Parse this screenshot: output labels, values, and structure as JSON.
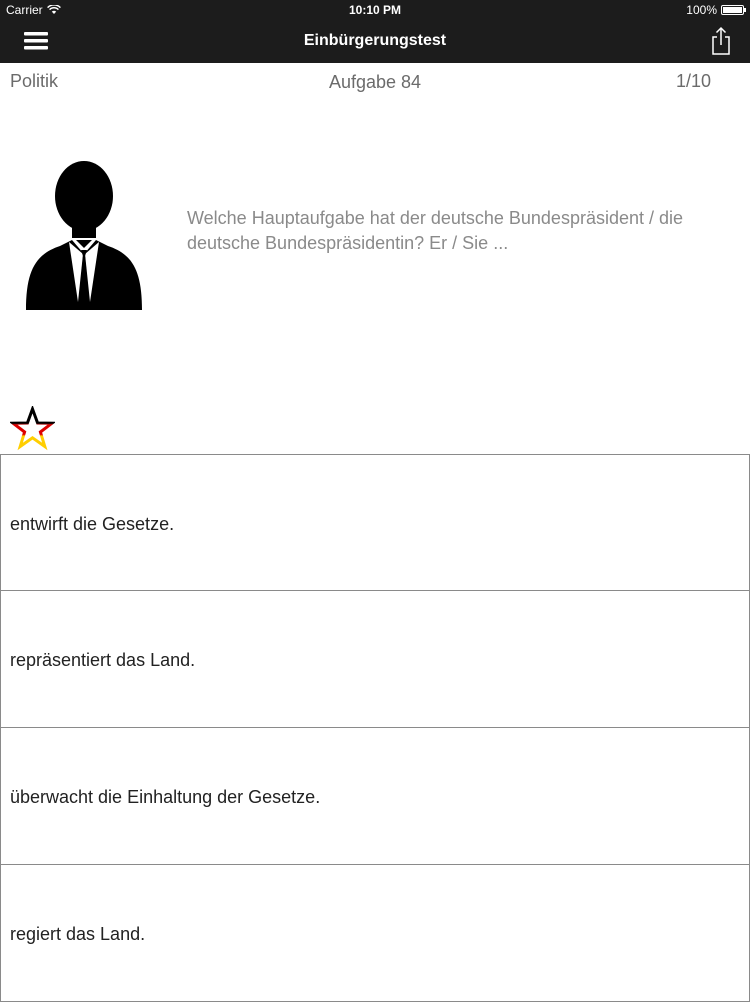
{
  "status_bar": {
    "carrier": "Carrier",
    "time": "10:10 PM",
    "battery": "100%"
  },
  "nav": {
    "title": "Einbürgerungstest",
    "menu_icon": "hamburger-menu-icon",
    "share_icon": "share-icon"
  },
  "header": {
    "category": "Politik",
    "task": "Aufgabe 84",
    "counter": "1/10"
  },
  "question": {
    "text": "Welche Hauptaufgabe hat der deutsche Bundespräsident / die deutsche Bundespräsidentin? Er / Sie ...",
    "image_icon": "person-silhouette-icon"
  },
  "favorite": {
    "icon": "star-icon",
    "colors": [
      "#000000",
      "#dd0000",
      "#ffce00"
    ]
  },
  "answers": [
    {
      "label": "entwirft die Gesetze."
    },
    {
      "label": "repräsentiert das Land."
    },
    {
      "label": "überwacht die Einhaltung der Gesetze."
    },
    {
      "label": "regiert das Land."
    }
  ]
}
